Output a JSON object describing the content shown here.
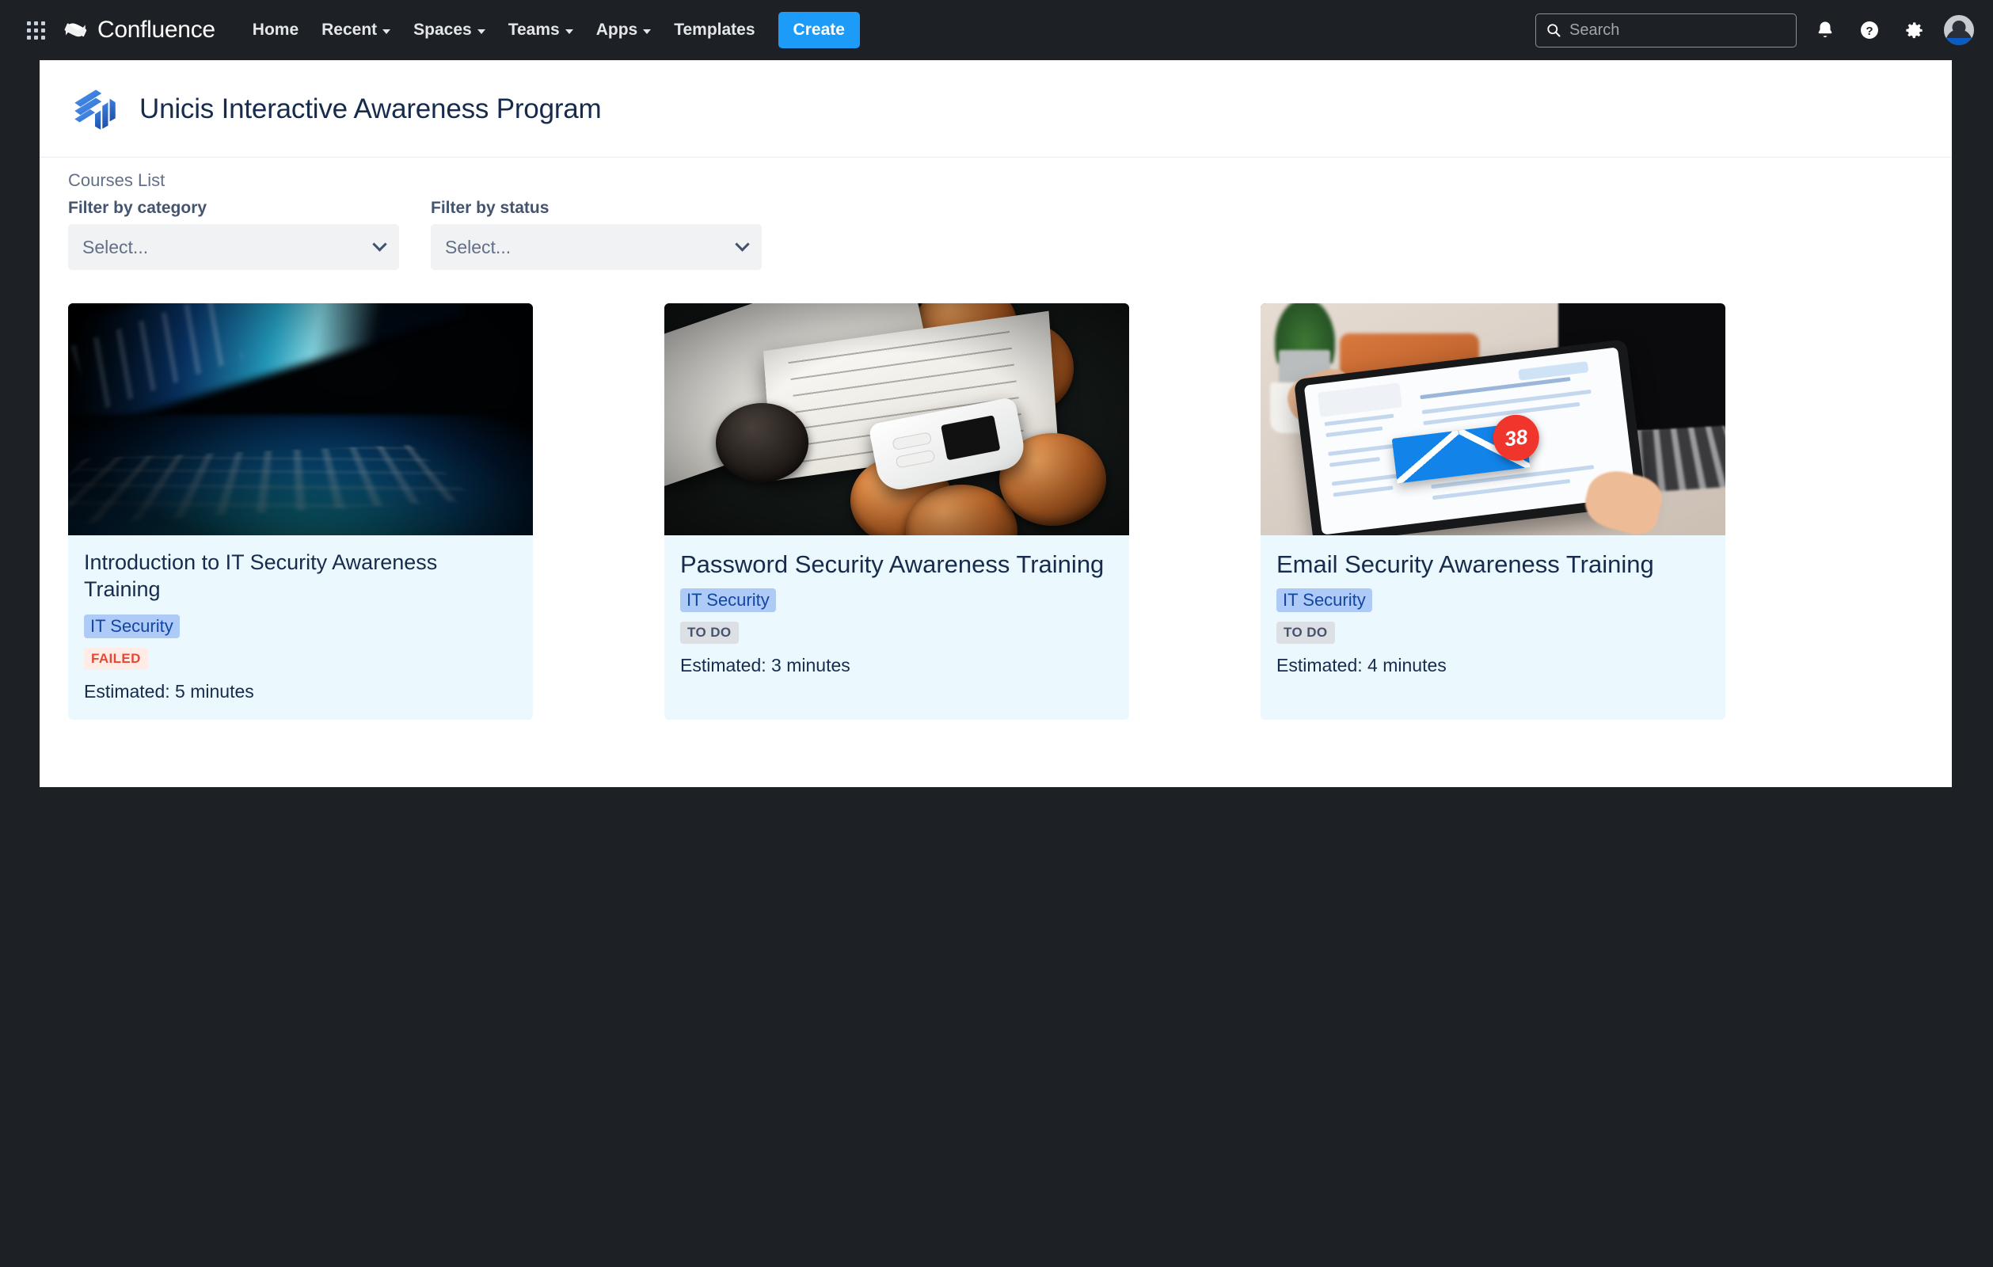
{
  "topnav": {
    "app_switcher_icon": "grid-apps-icon",
    "brand_name": "Confluence",
    "brand_icon": "confluence-logo-icon",
    "links": [
      {
        "label": "Home",
        "has_chevron": false
      },
      {
        "label": "Recent",
        "has_chevron": true
      },
      {
        "label": "Spaces",
        "has_chevron": true
      },
      {
        "label": "Teams",
        "has_chevron": true
      },
      {
        "label": "Apps",
        "has_chevron": true
      },
      {
        "label": "Templates",
        "has_chevron": false
      }
    ],
    "create_label": "Create",
    "search_placeholder": "Search",
    "search_value": "",
    "icons": [
      "notifications-bell-icon",
      "help-question-icon",
      "settings-gear-icon",
      "user-avatar"
    ],
    "background": "#1d2125",
    "create_color": "#1d9bf8"
  },
  "panel": {
    "logo_icon": "unicis-logo-icon",
    "title": "Unicis Interactive Awareness Program",
    "section_label": "Courses List",
    "filters": [
      {
        "label": "Filter by category",
        "value": "Select...",
        "chevron": "chevron-down-icon"
      },
      {
        "label": "Filter by status",
        "value": "Select...",
        "chevron": "chevron-down-icon"
      }
    ]
  },
  "courses": [
    {
      "title": "Introduction to IT Security Awareness Training",
      "category": "IT Security",
      "status": "FAILED",
      "status_kind": "failed",
      "estimate": "Estimated: 5 minutes",
      "thumb": "backlit-keyboard-image"
    },
    {
      "title": "Password Security Awareness Training",
      "category": "IT Security",
      "status": "TO DO",
      "status_kind": "todo",
      "estimate": "Estimated: 3 minutes",
      "thumb": "recovery-seed-card-coins-image"
    },
    {
      "title": "Email Security Awareness Training",
      "category": "IT Security",
      "status": "TO DO",
      "status_kind": "todo",
      "estimate": "Estimated: 4 minutes",
      "thumb": "tablet-email-inbox-image",
      "thumb_badge": "38"
    }
  ],
  "colors": {
    "card_bg": "#ebf8fd",
    "badge_bg": "#aecbf8",
    "badge_text": "#1446a0",
    "failed_bg": "#ffece6",
    "failed_text": "#e34935",
    "todo_bg": "#dcdfe4",
    "todo_text": "#44546f",
    "title_text": "#172b4d"
  }
}
